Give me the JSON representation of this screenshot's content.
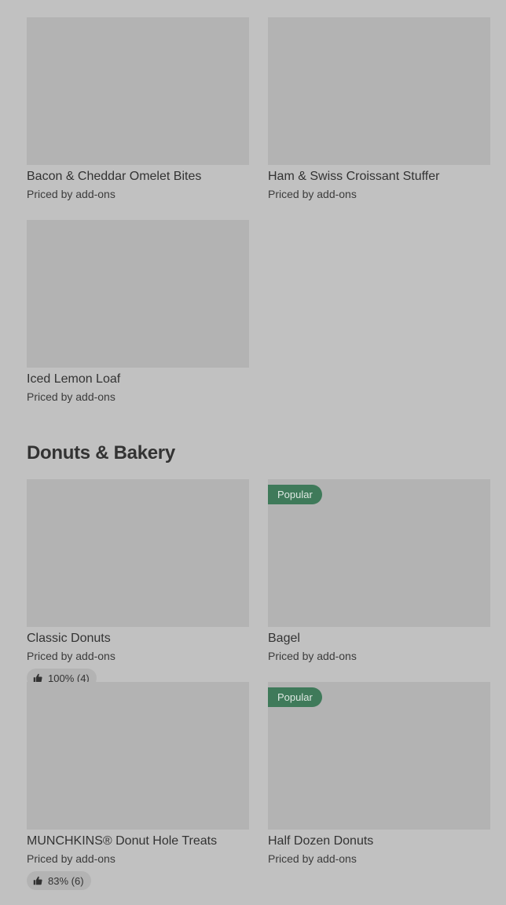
{
  "breakfast_items": [
    {
      "name": "Bacon & Cheddar Omelet Bites",
      "price": "Priced by add-ons"
    },
    {
      "name": "Ham & Swiss Croissant Stuffer",
      "price": "Priced by add-ons"
    },
    {
      "name": "Iced Lemon Loaf",
      "price": "Priced by add-ons"
    }
  ],
  "donuts_section": {
    "title": "Donuts & Bakery",
    "items": [
      {
        "name": "Classic Donuts",
        "price": "Priced by add-ons",
        "rating": "100% (4)"
      },
      {
        "name": "Bagel",
        "price": "Priced by add-ons",
        "badge": "Popular"
      },
      {
        "name": "MUNCHKINS® Donut Hole Treats",
        "price": "Priced by add-ons",
        "rating": "83% (6)"
      },
      {
        "name": "Half Dozen Donuts",
        "price": "Priced by add-ons",
        "badge": "Popular"
      }
    ]
  },
  "icons": {
    "rating": "thumbs-up-icon"
  },
  "colors": {
    "background": "#c1c1c1",
    "image_placeholder": "#b3b3b3",
    "popular_badge": "#3f7a5a",
    "text": "#333333"
  }
}
